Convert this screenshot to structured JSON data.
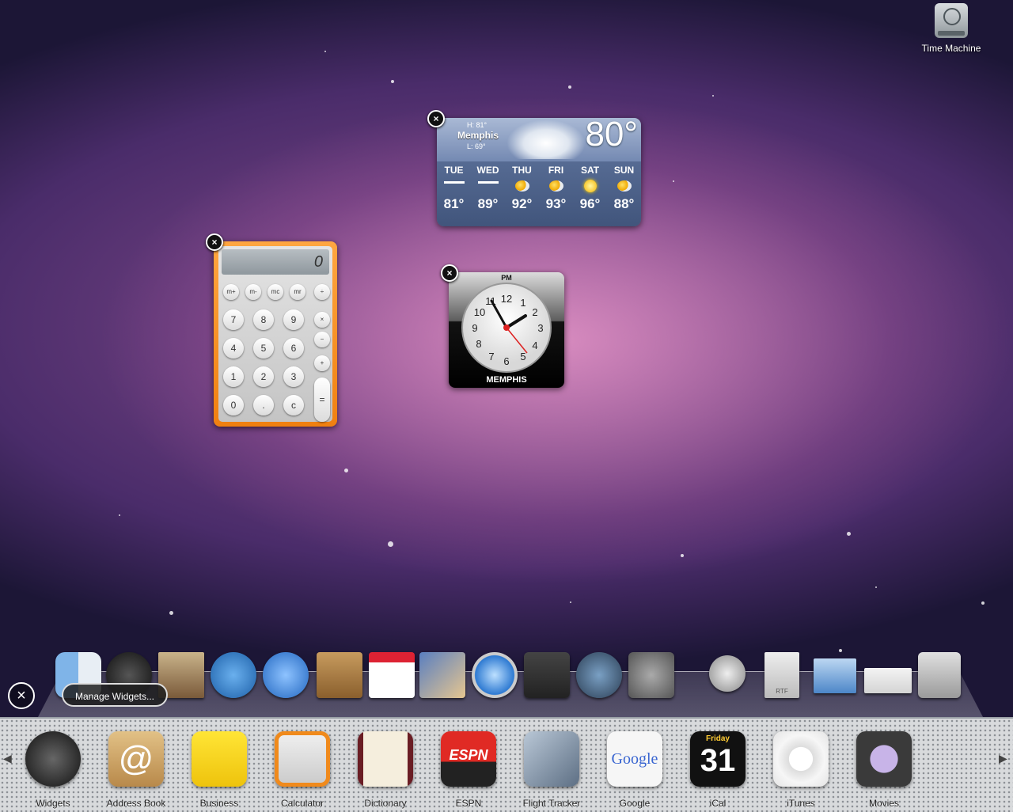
{
  "desktop": {
    "time_machine_label": "Time Machine"
  },
  "weather": {
    "high": "H: 81°",
    "low": "L: 69°",
    "city": "Memphis",
    "current_temp": "80°",
    "forecast": [
      {
        "day": "TUE",
        "temp": "81°",
        "icon": "thunderstorm-icon"
      },
      {
        "day": "WED",
        "temp": "89°",
        "icon": "thunderstorm-icon"
      },
      {
        "day": "THU",
        "temp": "92°",
        "icon": "partly-sunny-icon"
      },
      {
        "day": "FRI",
        "temp": "93°",
        "icon": "partly-sunny-icon"
      },
      {
        "day": "SAT",
        "temp": "96°",
        "icon": "sunny-icon"
      },
      {
        "day": "SUN",
        "temp": "88°",
        "icon": "partly-sunny-icon"
      }
    ]
  },
  "calculator": {
    "display": "0",
    "memory_keys": [
      "m+",
      "m-",
      "mc",
      "mr"
    ],
    "rows": [
      [
        "7",
        "8",
        "9"
      ],
      [
        "4",
        "5",
        "6"
      ],
      [
        "1",
        "2",
        "3"
      ],
      [
        "0",
        ".",
        "c"
      ]
    ],
    "ops": [
      "÷",
      "×",
      "−",
      "+"
    ],
    "equals": "="
  },
  "clock": {
    "meridiem": "PM",
    "city": "MEMPHIS",
    "numbers": [
      "12",
      "1",
      "2",
      "3",
      "4",
      "5",
      "6",
      "7",
      "8",
      "9",
      "10",
      "11"
    ]
  },
  "dock": {
    "manage_widgets_label": "Manage Widgets...",
    "close_all": "×",
    "rtf_label": "RTF"
  },
  "widget_bar": {
    "items": [
      {
        "label": "Widgets",
        "icon": "widgets-icon",
        "color": "#3b3b3b"
      },
      {
        "label": "Address Book",
        "icon": "at-sign-icon",
        "color": "#c99b4e"
      },
      {
        "label": "Business",
        "icon": "phonebook-icon",
        "color": "#f1d21a"
      },
      {
        "label": "Calculator",
        "icon": "calculator-icon",
        "color": "#f08a1c"
      },
      {
        "label": "Dictionary",
        "icon": "dictionary-icon",
        "color": "#6a1d24"
      },
      {
        "label": "ESPN",
        "icon": "espn-icon",
        "color": "#d8221e"
      },
      {
        "label": "Flight Tracker",
        "icon": "airplane-icon",
        "color": "#7d8a99"
      },
      {
        "label": "Google",
        "icon": "google-icon",
        "color": "#f4f4f4"
      },
      {
        "label": "iCal",
        "icon": "calendar-icon",
        "color": "#111111"
      },
      {
        "label": "iTunes",
        "icon": "itunes-icon",
        "color": "#e9e9e9"
      },
      {
        "label": "Movies",
        "icon": "ticket-icon",
        "color": "#2a2a2a"
      }
    ],
    "ical_day": "Friday",
    "ical_date": "31",
    "espn_text": "ESPN",
    "google_text": "Google"
  },
  "colors": {
    "accent_orange": "#f08010",
    "weather_blue": "#566b93"
  }
}
